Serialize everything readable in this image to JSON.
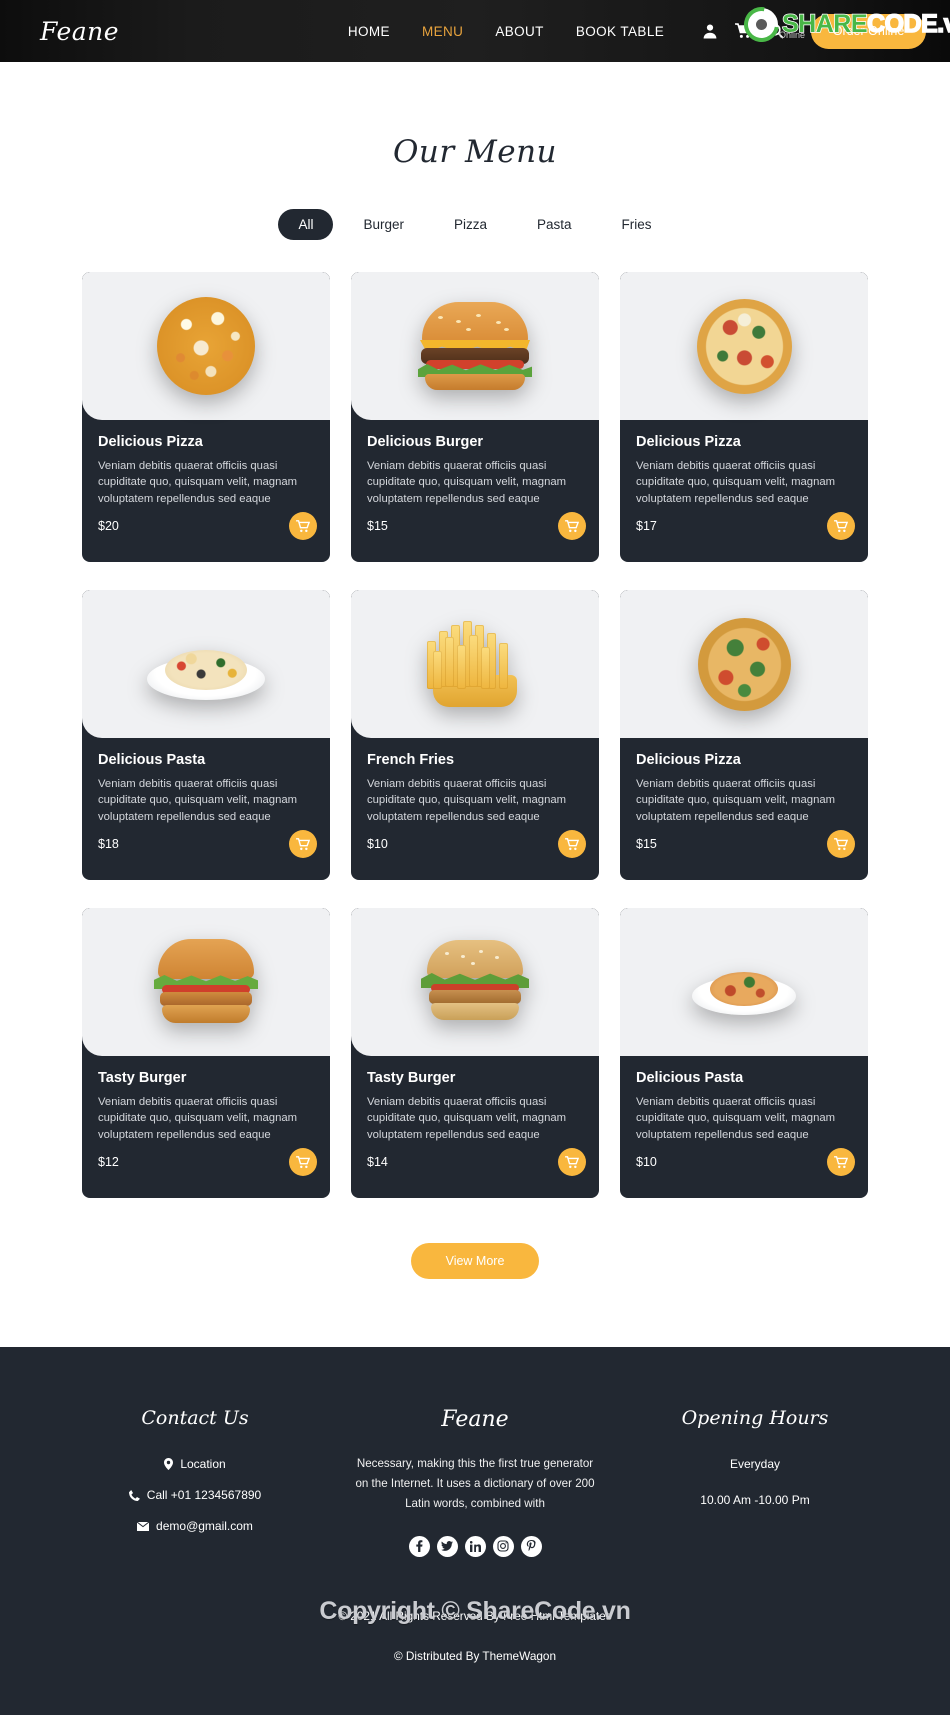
{
  "header": {
    "brand": "Feane",
    "nav": [
      {
        "label": "HOME",
        "active": false
      },
      {
        "label": "MENU",
        "active": true
      },
      {
        "label": "ABOUT",
        "active": false
      },
      {
        "label": "BOOK TABLE",
        "active": false
      }
    ],
    "icons": [
      "user-icon",
      "cart-icon",
      "search-icon"
    ],
    "order_button": "Order Online"
  },
  "watermarks": {
    "header_share": "SHARE",
    "header_code": "CODE",
    "header_vn": ".vn",
    "header_sub": "Online",
    "middle": "ShareCode.vn",
    "bottom": "Copyright © ShareCode.vn"
  },
  "menu": {
    "title": "Our Menu",
    "filters": [
      {
        "label": "All",
        "active": true
      },
      {
        "label": "Burger",
        "active": false
      },
      {
        "label": "Pizza",
        "active": false
      },
      {
        "label": "Pasta",
        "active": false
      },
      {
        "label": "Fries",
        "active": false
      }
    ],
    "description": "Veniam debitis quaerat officiis quasi cupiditate quo, quisquam velit, magnam voluptatem repellendus sed eaque",
    "items": [
      {
        "name": "Delicious Pizza",
        "price": "$20",
        "image": "pizza-a",
        "desc": "Veniam debitis quaerat officiis quasi cupiditate quo, quisquam velit, magnam voluptatem repellendus sed eaque"
      },
      {
        "name": "Delicious Burger",
        "price": "$15",
        "image": "burger-a",
        "desc": "Veniam debitis quaerat officiis quasi cupiditate quo, quisquam velit, magnam voluptatem repellendus sed eaque"
      },
      {
        "name": "Delicious Pizza",
        "price": "$17",
        "image": "pizza-b",
        "desc": "Veniam debitis quaerat officiis quasi cupiditate quo, quisquam velit, magnam voluptatem repellendus sed eaque"
      },
      {
        "name": "Delicious Pasta",
        "price": "$18",
        "image": "pasta-a",
        "desc": "Veniam debitis quaerat officiis quasi cupiditate quo, quisquam velit, magnam voluptatem repellendus sed eaque"
      },
      {
        "name": "French Fries",
        "price": "$10",
        "image": "fries",
        "desc": "Veniam debitis quaerat officiis quasi cupiditate quo, quisquam velit, magnam voluptatem repellendus sed eaque"
      },
      {
        "name": "Delicious Pizza",
        "price": "$15",
        "image": "pizza-c",
        "desc": "Veniam debitis quaerat officiis quasi cupiditate quo, quisquam velit, magnam voluptatem repellendus sed eaque"
      },
      {
        "name": "Tasty Burger",
        "price": "$12",
        "image": "burger-b",
        "desc": "Veniam debitis quaerat officiis quasi cupiditate quo, quisquam velit, magnam voluptatem repellendus sed eaque"
      },
      {
        "name": "Tasty Burger",
        "price": "$14",
        "image": "burger-c",
        "desc": "Veniam debitis quaerat officiis quasi cupiditate quo, quisquam velit, magnam voluptatem repellendus sed eaque"
      },
      {
        "name": "Delicious Pasta",
        "price": "$10",
        "image": "pasta-b",
        "desc": "Veniam debitis quaerat officiis quasi cupiditate quo, quisquam velit, magnam voluptatem repellendus sed eaque"
      }
    ],
    "view_more": "View More"
  },
  "footer": {
    "contact": {
      "heading": "Contact Us",
      "location": "Location",
      "phone": "Call +01 1234567890",
      "email": "demo@gmail.com"
    },
    "brand": {
      "heading": "Feane",
      "about": "Necessary, making this the first true generator on the Internet. It uses a dictionary of over 200 Latin words, combined with",
      "socials": [
        "facebook-icon",
        "twitter-icon",
        "linkedin-icon",
        "instagram-icon",
        "pinterest-icon"
      ]
    },
    "hours": {
      "heading": "Opening Hours",
      "days": "Everyday",
      "time": "10.00 Am -10.00 Pm"
    },
    "copyright": "© 2021 All Rights Reserved By Free Html Templates",
    "distributed": "© Distributed By ThemeWagon"
  },
  "colors": {
    "dark": "#222831",
    "accent": "#f9b73e",
    "nav_active": "#e8a33d",
    "panel": "#f0f1f3"
  }
}
